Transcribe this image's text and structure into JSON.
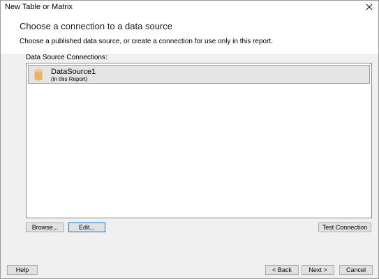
{
  "window": {
    "title": "New Table or Matrix",
    "close_glyph": "✕"
  },
  "header": {
    "title": "Choose a connection to a data source",
    "subtitle": "Choose a published data source, or create a connection for use only in this report."
  },
  "connections": {
    "label": "Data Source Connections:",
    "items": [
      {
        "name": "DataSource1",
        "location": "(in this Report)",
        "icon": "database-icon",
        "selected": true
      }
    ]
  },
  "actions": {
    "browse_label": "Browse...",
    "edit_label": "Edit...",
    "test_label": "Test Connection"
  },
  "footer": {
    "help_label": "Help",
    "back_label": "< Back",
    "next_label": "Next >",
    "cancel_label": "Cancel"
  },
  "colors": {
    "accent": "#0078d7",
    "panel_bg": "#f0f0f0",
    "selection_bg": "#e5e5e5",
    "database_icon": "#e8b463"
  }
}
